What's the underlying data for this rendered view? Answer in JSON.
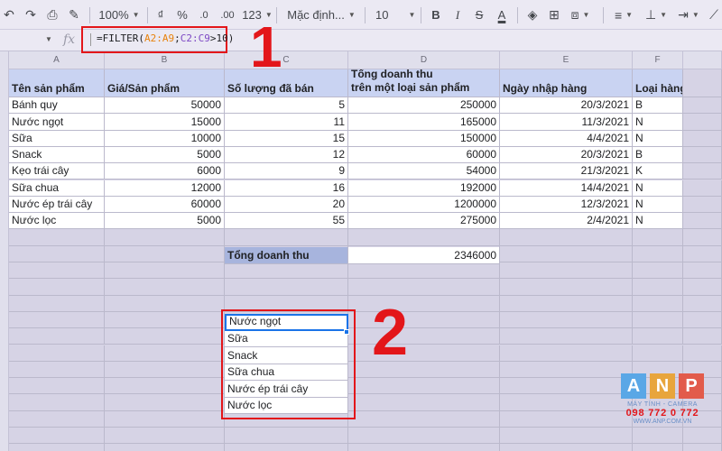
{
  "toolbar": {
    "zoom": "100%",
    "currency": "₫",
    "percent": "%",
    "dec_decrease": ".0",
    "dec_increase": ".00",
    "more_formats": "123",
    "font": "Mặc định...",
    "font_size": "10",
    "bold": "B",
    "italic": "I",
    "strike": "S",
    "text_color": "A"
  },
  "formula_bar": {
    "fx": "fx",
    "formula_prefix": "=FILTER(",
    "arg1": "A2:A9",
    "sep": ";",
    "arg2": "C2:C9",
    "formula_suffix": ">10)"
  },
  "columns": [
    "A",
    "B",
    "C",
    "D",
    "E",
    "F"
  ],
  "headers": {
    "name": "Tên sản phẩm",
    "price": "Giá/Sản phẩm",
    "qty": "Số lượng đã bán",
    "revenue_line1": "Tổng doanh thu",
    "revenue_line2": "trên một loại sản phẩm",
    "date": "Ngày nhập hàng",
    "type": "Loại hàng"
  },
  "rows": [
    {
      "name": "Bánh quy",
      "price": "50000",
      "qty": "5",
      "revenue": "250000",
      "date": "20/3/2021",
      "type": "B"
    },
    {
      "name": "Nước ngọt",
      "price": "15000",
      "qty": "11",
      "revenue": "165000",
      "date": "11/3/2021",
      "type": "N"
    },
    {
      "name": "Sữa",
      "price": "10000",
      "qty": "15",
      "revenue": "150000",
      "date": "4/4/2021",
      "type": "N"
    },
    {
      "name": "Snack",
      "price": "5000",
      "qty": "12",
      "revenue": "60000",
      "date": "20/3/2021",
      "type": "B"
    },
    {
      "name": "Kẹo trái cây",
      "price": "6000",
      "qty": "9",
      "revenue": "54000",
      "date": "21/3/2021",
      "type": "K"
    },
    {
      "name": "Sữa chua",
      "price": "12000",
      "qty": "16",
      "revenue": "192000",
      "date": "14/4/2021",
      "type": "N"
    },
    {
      "name": "Nước ép trái cây",
      "price": "60000",
      "qty": "20",
      "revenue": "1200000",
      "date": "12/3/2021",
      "type": "N"
    },
    {
      "name": "Nước lọc",
      "price": "5000",
      "qty": "55",
      "revenue": "275000",
      "date": "2/4/2021",
      "type": "N"
    }
  ],
  "total": {
    "label": "Tổng doanh thu",
    "value": "2346000"
  },
  "filter_results": [
    "Nước ngọt",
    "Sữa",
    "Snack",
    "Sữa chua",
    "Nước ép trái cây",
    "Nước lọc"
  ],
  "annotations": {
    "step1": "1",
    "step2": "2"
  },
  "logo": {
    "a": "A",
    "n": "N",
    "p": "P",
    "tagline": "MÁY TÍNH - CAMERA",
    "phone": "098 772 0 772",
    "website": "WWW.ANP.COM.VN"
  },
  "colors": {
    "highlight_red": "#e3161a",
    "header_fill": "#c9d3f2",
    "selection_blue": "#1a73e8"
  }
}
